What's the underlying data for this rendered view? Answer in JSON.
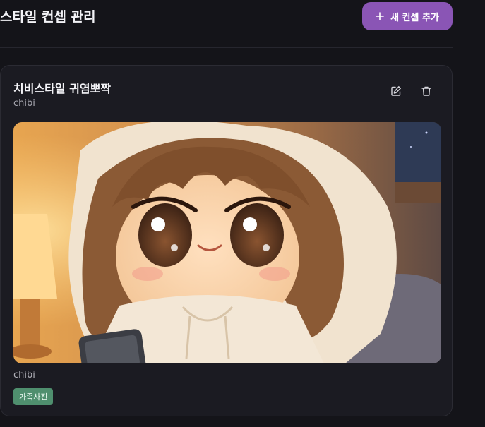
{
  "header": {
    "title": "스타일 컨셉 관리",
    "add_button_label": "새 컨셉 추가",
    "accent_color": "#8a55b5"
  },
  "concept_card": {
    "title": "치비스타일 귀염뽀짝",
    "subtitle": "chibi",
    "image_caption": "chibi",
    "tag": "가족사진",
    "tag_color": "#4f8f6e",
    "actions": [
      "edit-icon",
      "trash-icon"
    ]
  }
}
